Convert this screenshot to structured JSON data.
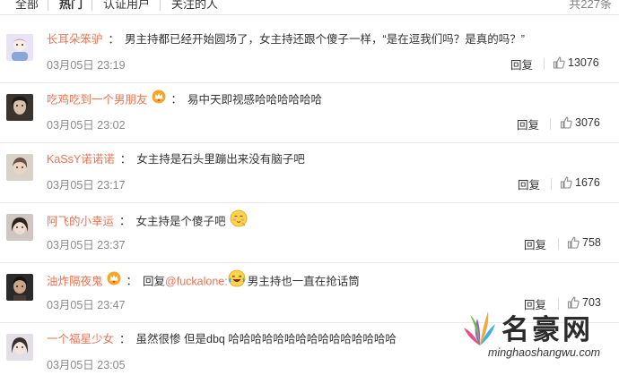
{
  "tabs": [
    {
      "label": "全部"
    },
    {
      "label": "热门",
      "active": true
    },
    {
      "label": "认证用户"
    },
    {
      "label": "关注的人"
    }
  ],
  "total_count": "共227条",
  "reply_label": "回复",
  "comments": [
    {
      "user": "长耳朵笨驴",
      "text": "男主持都已经开始圆场了，女主持还跟个傻子一样，“是在逗我们吗？是真的吗？”",
      "time": "03月05日 23:19",
      "likes": "13076"
    },
    {
      "user": "吃鸡吃到一个男朋友",
      "text": "易中天即视感哈哈哈哈哈哈",
      "time": "03月05日 23:02",
      "likes": "3076"
    },
    {
      "user": "KaSsY诺诺诺",
      "text": "女主持是石头里蹦出来没有脑子吧",
      "time": "03月05日 23:17",
      "likes": "1676"
    },
    {
      "user": "阿飞的小幸运",
      "text": "女主持是个傻子吧",
      "time": "03月05日 23:37",
      "likes": "758"
    },
    {
      "user": "油炸隔夜鬼",
      "text_prefix": "回复",
      "mention": "@fuckalone:",
      "text": "男主持也一直在抢话筒",
      "time": "03月05日 23:47",
      "likes": "703"
    },
    {
      "user": "一个福星少女",
      "text": "虽然很惨 但是dbq 哈哈哈哈哈哈哈哈哈哈哈哈哈哈哈",
      "time": "03月05日 23:05",
      "likes": ""
    }
  ],
  "icons": {
    "like": "thumbs-up-icon",
    "vip_badge": "crown-badge-icon",
    "emoji_shy": "shy-face-emoji-icon",
    "emoji_laugh": "laughing-tears-emoji-icon"
  },
  "colors": {
    "username": "#eb7350",
    "text": "#333333",
    "time": "#8a8a8a",
    "divider": "#e8e8e8",
    "badge": "#f6a623"
  },
  "watermark": {
    "brand": "名豪网",
    "url": "minghaoshangwu.com"
  }
}
